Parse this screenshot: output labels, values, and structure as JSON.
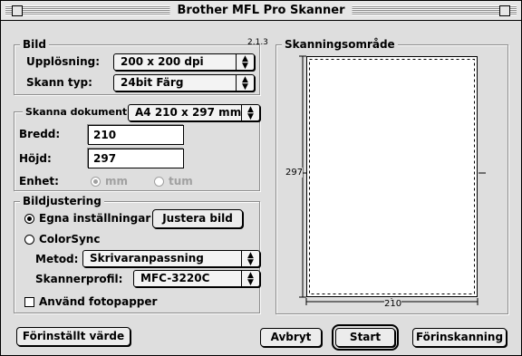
{
  "window": {
    "title": "Brother MFL Pro Skanner",
    "version": "2.1.3"
  },
  "bild": {
    "group_label": "Bild",
    "resolution_label": "Upplösning:",
    "resolution_value": "200 x 200 dpi",
    "scan_type_label": "Skann typ:",
    "scan_type_value": "24bit Färg"
  },
  "document": {
    "size_label": "Skanna dokument",
    "size_value": "A4 210 x 297 mm",
    "width_label": "Bredd:",
    "width_value": "210",
    "height_label": "Höjd:",
    "height_value": "297",
    "unit_label": "Enhet:",
    "unit_mm": "mm",
    "unit_tum": "tum",
    "unit_selected": "mm"
  },
  "adjust": {
    "group_label": "Bildjustering",
    "custom_label": "Egna inställningar",
    "adjust_button": "Justera bild",
    "colorsync_label": "ColorSync",
    "method_label": "Metod:",
    "method_value": "Skrivaranpassning",
    "profile_label": "Skannerprofil:",
    "profile_value": "MFC-3220C",
    "photo_paper_label": "Använd fotopapper",
    "selected_mode": "Egna inställningar",
    "photo_paper_checked": false
  },
  "scan_area": {
    "label": "Skanningsområde",
    "height_mark": "297",
    "width_mark": "210"
  },
  "buttons": {
    "defaults": "Förinställt värde",
    "cancel": "Avbryt",
    "start": "Start",
    "prescan": "Förinskanning"
  }
}
